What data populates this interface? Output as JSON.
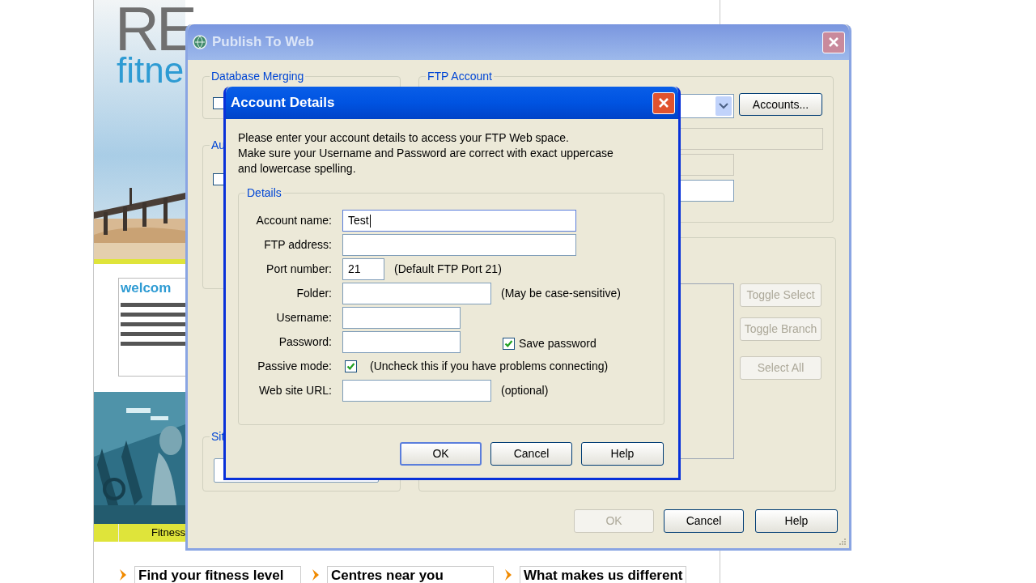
{
  "website": {
    "logo_top": "RE",
    "logo_bottom": "fitne",
    "welcome_heading": "welcom",
    "caption": "Fitness",
    "links": [
      {
        "label": "Find your fitness level"
      },
      {
        "label": "Centres near you"
      },
      {
        "label": "What makes us different"
      }
    ]
  },
  "publish_window": {
    "title": "Publish To Web",
    "active": false,
    "groups": [
      {
        "label": "Database Merging",
        "checked": false
      },
      {
        "label": "FTP Account"
      },
      {
        "label": "Au",
        "checked": false
      },
      {
        "label": "Sit"
      }
    ],
    "accounts_button": "Accounts...",
    "tree_buttons": [
      {
        "label": "Toggle Select",
        "disabled": true
      },
      {
        "label": "Toggle Branch",
        "disabled": true
      },
      {
        "label": "Select All",
        "disabled": true
      }
    ],
    "buttons": [
      {
        "label": "OK",
        "disabled": true
      },
      {
        "label": "Cancel",
        "disabled": false
      },
      {
        "label": "Help",
        "disabled": false
      }
    ]
  },
  "account_dialog": {
    "title": "Account Details",
    "active": true,
    "intro": "Please enter your account details to access your FTP Web space.\nMake sure your Username and Password are correct with exact uppercase\nand lowercase spelling.",
    "group": "Details",
    "fields": [
      {
        "kind": "field",
        "label": "Account name:",
        "value": "Test",
        "focused": true
      },
      {
        "kind": "field",
        "label": "FTP address:",
        "focused": false
      },
      {
        "kind": "field",
        "label": "Port number:",
        "value": "21",
        "note": "(Default FTP Port 21)",
        "focused": false
      },
      {
        "kind": "field",
        "label": "Folder:",
        "note": "(May be case-sensitive)",
        "focused": false
      },
      {
        "kind": "field",
        "label": "Username:",
        "focused": false
      },
      {
        "kind": "field",
        "label": "Password:",
        "focused": false,
        "checkbox": {
          "label": "Save password",
          "checked": true
        }
      },
      {
        "kind": "checkbox",
        "label": "Passive mode:",
        "checked": true,
        "note": "(Uncheck this if you have problems connecting)"
      },
      {
        "kind": "field",
        "label": "Web site URL:",
        "note": "(optional)",
        "focused": false
      }
    ],
    "buttons": [
      {
        "label": "OK",
        "default": true
      },
      {
        "label": "Cancel",
        "default": false
      },
      {
        "label": "Help",
        "default": false
      }
    ]
  }
}
